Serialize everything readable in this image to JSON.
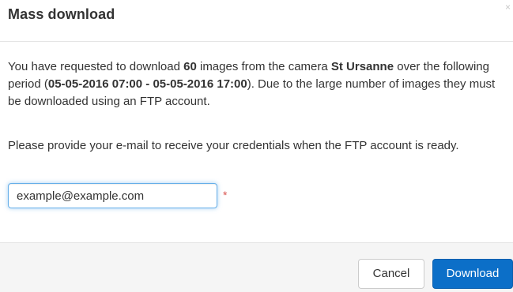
{
  "dialog": {
    "title": "Mass download",
    "close_label": "×"
  },
  "body": {
    "p1_prefix": "You have requested to download ",
    "image_count": "60",
    "p1_mid": " images from the camera ",
    "camera_name": "St Ursanne",
    "p1_mid2": " over the following period (",
    "period": "05-05-2016 07:00 - 05-05-2016 17:00",
    "p1_suffix": "). Due to the large number of images they must be downloaded using an FTP account.",
    "p2": "Please provide your e-mail to receive your credentials when the FTP account is ready."
  },
  "email_field": {
    "value": "example@example.com",
    "required_mark": "*"
  },
  "footer": {
    "cancel_label": "Cancel",
    "download_label": "Download"
  },
  "colors": {
    "primary": "#0c6fc8",
    "required": "#d9534f",
    "focus_border": "#66afe9"
  }
}
